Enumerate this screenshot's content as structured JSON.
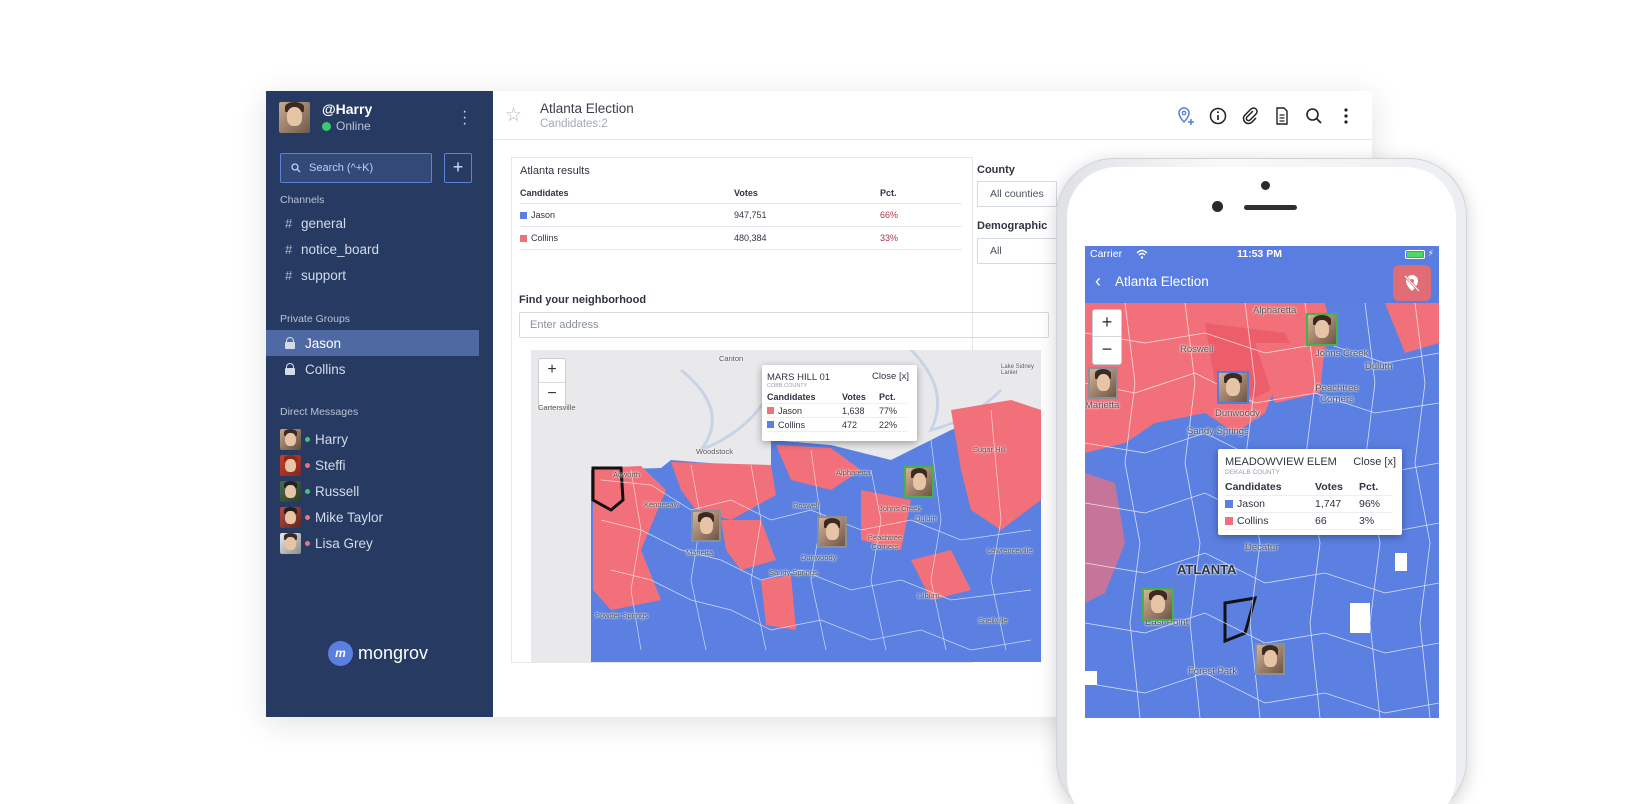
{
  "colors": {
    "sidebar": "#263a62",
    "accent": "#5a7de2",
    "jason": "#5b80e2",
    "collins": "#f2707a",
    "online": "#3cc96b",
    "away": "#f2707a"
  },
  "user": {
    "name": "@Harry",
    "status": "Online"
  },
  "search": {
    "placeholder": "Search (^+K)"
  },
  "sections": {
    "channels": "Channels",
    "private_groups": "Private Groups",
    "direct_messages": "Direct Messages"
  },
  "channels": [
    {
      "label": "general"
    },
    {
      "label": "notice_board"
    },
    {
      "label": "support"
    }
  ],
  "private_groups": [
    {
      "label": "Jason",
      "active": true
    },
    {
      "label": "Collins",
      "active": false
    }
  ],
  "direct_messages": [
    {
      "label": "Harry",
      "status": "online"
    },
    {
      "label": "Steffi",
      "status": "away"
    },
    {
      "label": "Russell",
      "status": "online"
    },
    {
      "label": "Mike Taylor",
      "status": "away"
    },
    {
      "label": "Lisa Grey",
      "status": "away"
    }
  ],
  "brand": {
    "logo_letter": "m",
    "name": "mongrov"
  },
  "room": {
    "title": "Atlanta Election",
    "subtitle": "Candidates:2"
  },
  "header_icons": [
    "location-add-icon",
    "info-icon",
    "paperclip-icon",
    "document-icon",
    "search-icon",
    "more-vertical-icon"
  ],
  "results": {
    "title": "Atlanta results",
    "columns": [
      "Candidates",
      "Votes",
      "Pct."
    ],
    "rows": [
      {
        "candidate": "Jason",
        "votes": "947,751",
        "pct": "66%",
        "color": "#5b80e2"
      },
      {
        "candidate": "Collins",
        "votes": "480,384",
        "pct": "33%",
        "color": "#f2707a"
      }
    ]
  },
  "filters": {
    "county_label": "County",
    "county_value": "All counties",
    "demographic_label": "Demographic",
    "demographic_value": "All"
  },
  "neighborhood": {
    "label": "Find your neighborhood",
    "placeholder": "Enter address"
  },
  "map": {
    "zoom_in": "+",
    "zoom_out": "−",
    "places": [
      "Canton",
      "Cartersville",
      "Woodstock",
      "Acworth",
      "Kennesaw",
      "Marietta",
      "Alpharetta",
      "Roswell",
      "Johns Creek",
      "Duluth",
      "Dunwoody",
      "Peachtree Corners",
      "Sandy Springs",
      "Sugar Hill",
      "Lawrenceville",
      "Lilburn",
      "Powder Springs",
      "Snellville",
      "Lake Sidney Lanier"
    ],
    "popup": {
      "title": "MARS HILL 01",
      "county": "COBB COUNTY",
      "close": "Close [x]",
      "columns": [
        "Candidates",
        "Votes",
        "Pct."
      ],
      "rows": [
        {
          "candidate": "Jason",
          "votes": "1,638",
          "pct": "77%",
          "color": "#f2707a"
        },
        {
          "candidate": "Collins",
          "votes": "472",
          "pct": "22%",
          "color": "#5b80e2"
        }
      ]
    }
  },
  "phone": {
    "carrier": "Carrier",
    "time": "11:53 PM",
    "title": "Atlanta Election",
    "zoom_in": "+",
    "zoom_out": "−",
    "places": [
      "Alpharetta",
      "Roswell",
      "Johns Creek",
      "Duluth",
      "Peachtree Corners",
      "Dunwoody",
      "Sandy Springs",
      "Marietta",
      "ATLANTA",
      "Decatur",
      "East Point",
      "Forest Park"
    ],
    "popup": {
      "title": "MEADOWVIEW ELEM",
      "county": "DEKALB COUNTY",
      "close": "Close [x]",
      "columns": [
        "Candidates",
        "Votes",
        "Pct."
      ],
      "rows": [
        {
          "candidate": "Jason",
          "votes": "1,747",
          "pct": "96%",
          "color": "#5b80e2"
        },
        {
          "candidate": "Collins",
          "votes": "66",
          "pct": "3%",
          "color": "#f2707a"
        }
      ]
    }
  }
}
